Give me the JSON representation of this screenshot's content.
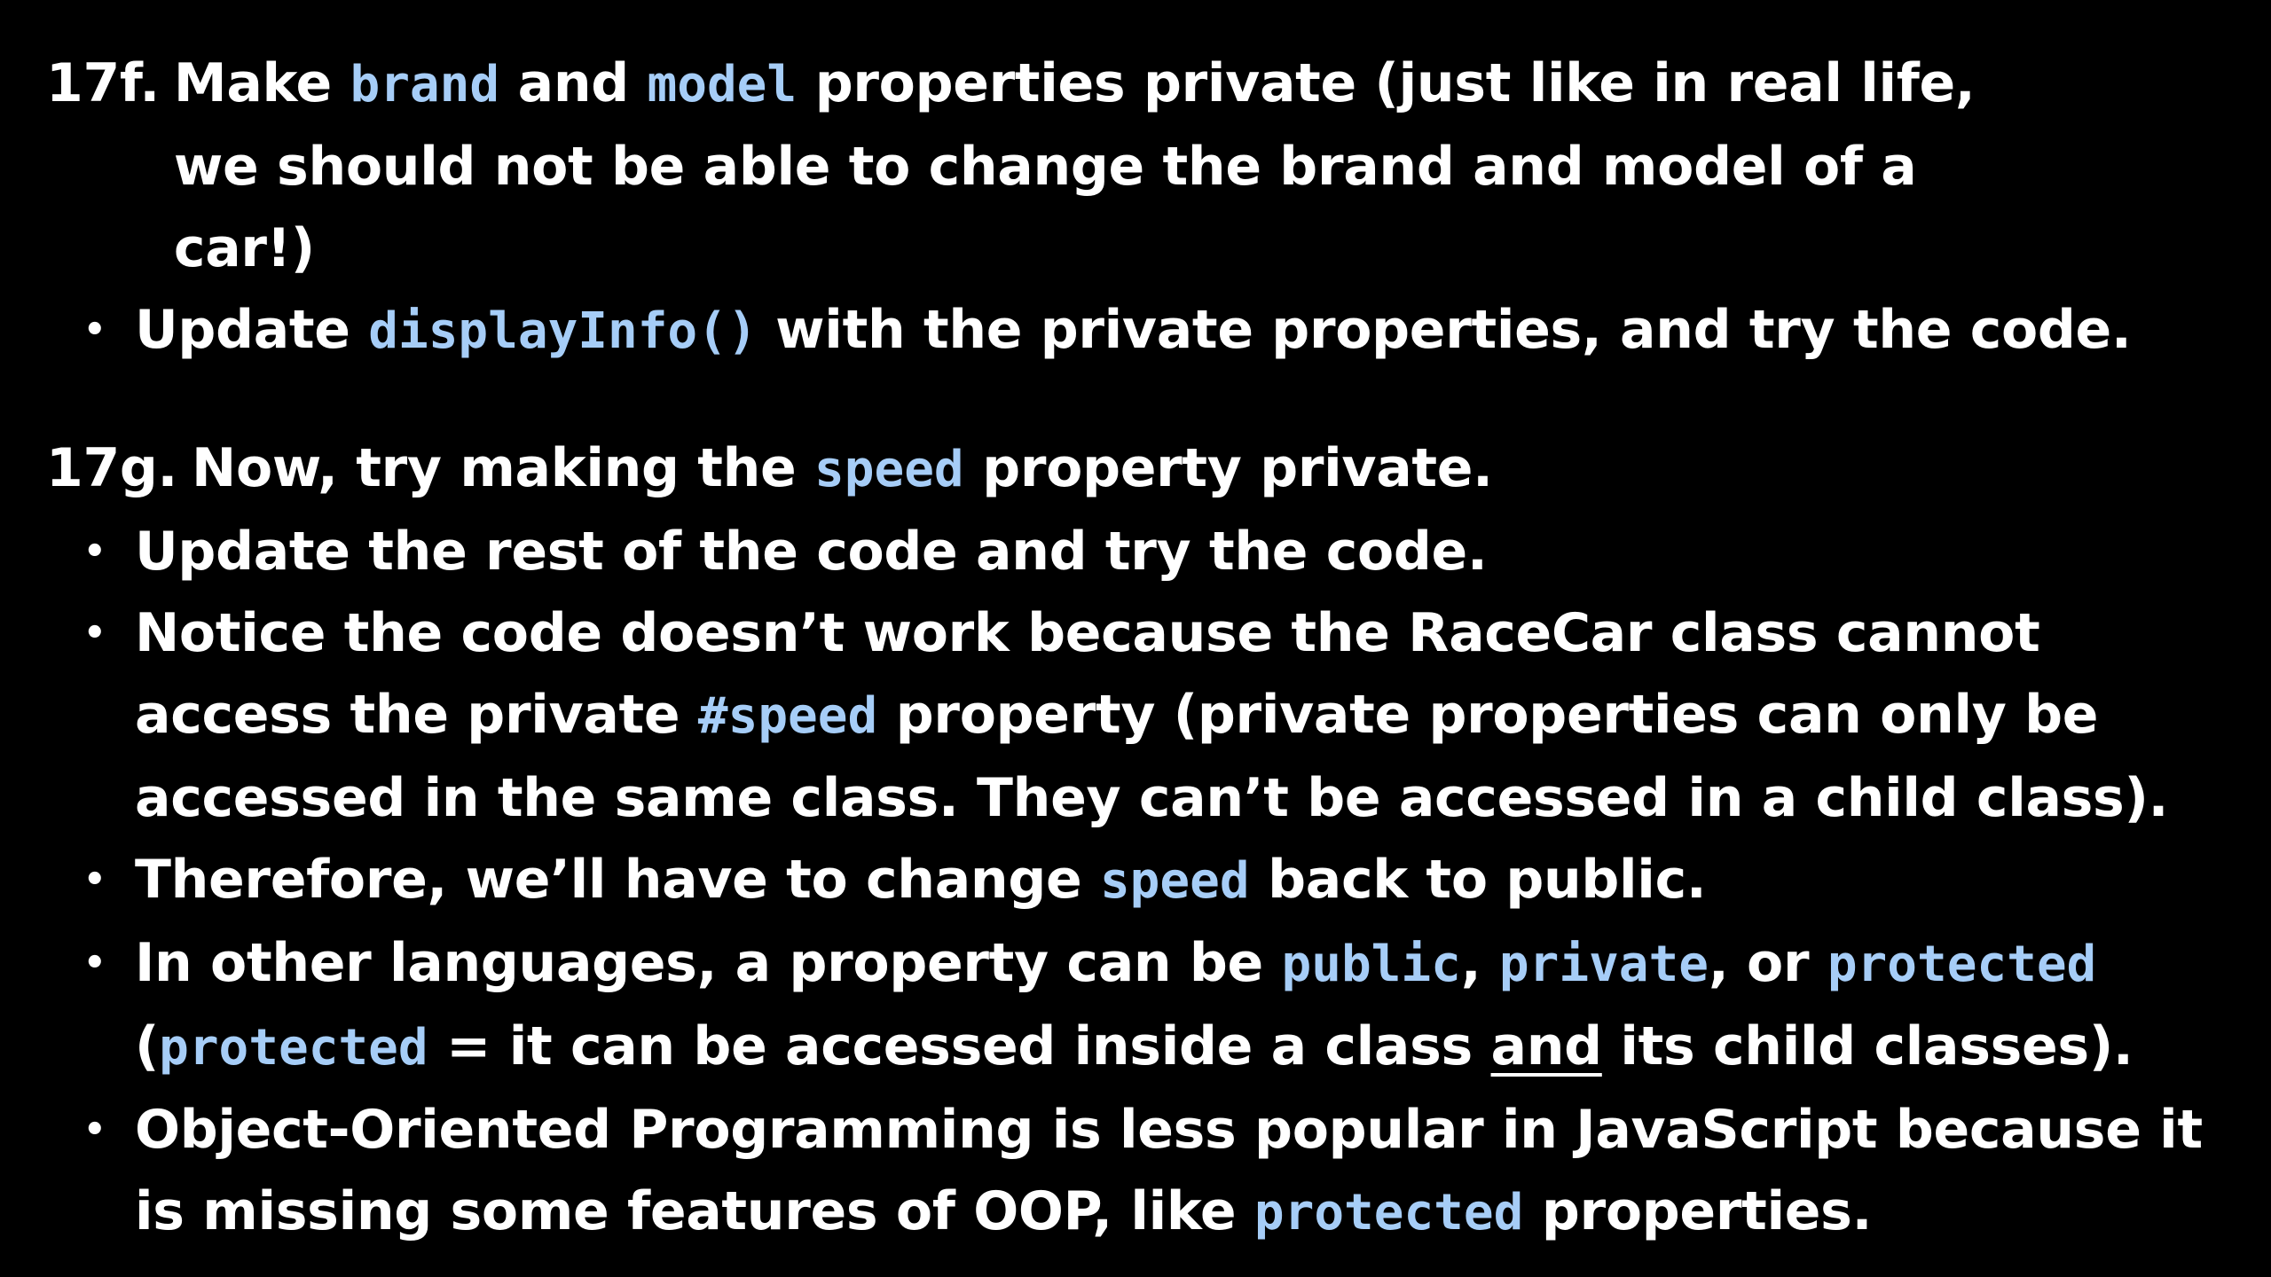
{
  "exercise_f": {
    "number": "17f.",
    "t1": "Make",
    "c1": "brand",
    "t2": "and",
    "c2": "model",
    "t3": "properties private (just like in real life, we should not be able to change the brand and model of a car!)",
    "bullet1": {
      "t1": "Update",
      "c1": "displayInfo()",
      "t2": "with the private properties, and try the code."
    }
  },
  "exercise_g": {
    "number": "17g.",
    "t1": "Now, try making the",
    "c1": "speed",
    "t2": "property private.",
    "bullet1": {
      "t1": "Update the rest of the code and try the code."
    },
    "bullet2": {
      "t1": "Notice the code doesn’t work because the RaceCar class cannot access the private",
      "c1": "#speed",
      "t2": "property (private properties can only be accessed in the same class. They can’t be accessed in a child class)."
    },
    "bullet3": {
      "t1": "Therefore, we’ll have to change",
      "c1": "speed",
      "t2": "back to public."
    },
    "bullet4": {
      "t1": "In other languages, a property can be",
      "c1": "public",
      "t2": ",",
      "c2": "private",
      "t3": ", or",
      "c3": "protected",
      "t4": "(",
      "c4": "protected",
      "t5": "= it can be accessed inside a class",
      "u1": "and",
      "t6": "its child classes)."
    },
    "bullet5": {
      "t1": "Object-Oriented Programming is less popular in JavaScript because it is missing some features of OOP, like",
      "c1": "protected",
      "t2": "properties."
    }
  },
  "bullet_glyph": "•",
  "colors": {
    "background": "#000000",
    "text": "#ffffff",
    "code": "#a6cdf7"
  }
}
